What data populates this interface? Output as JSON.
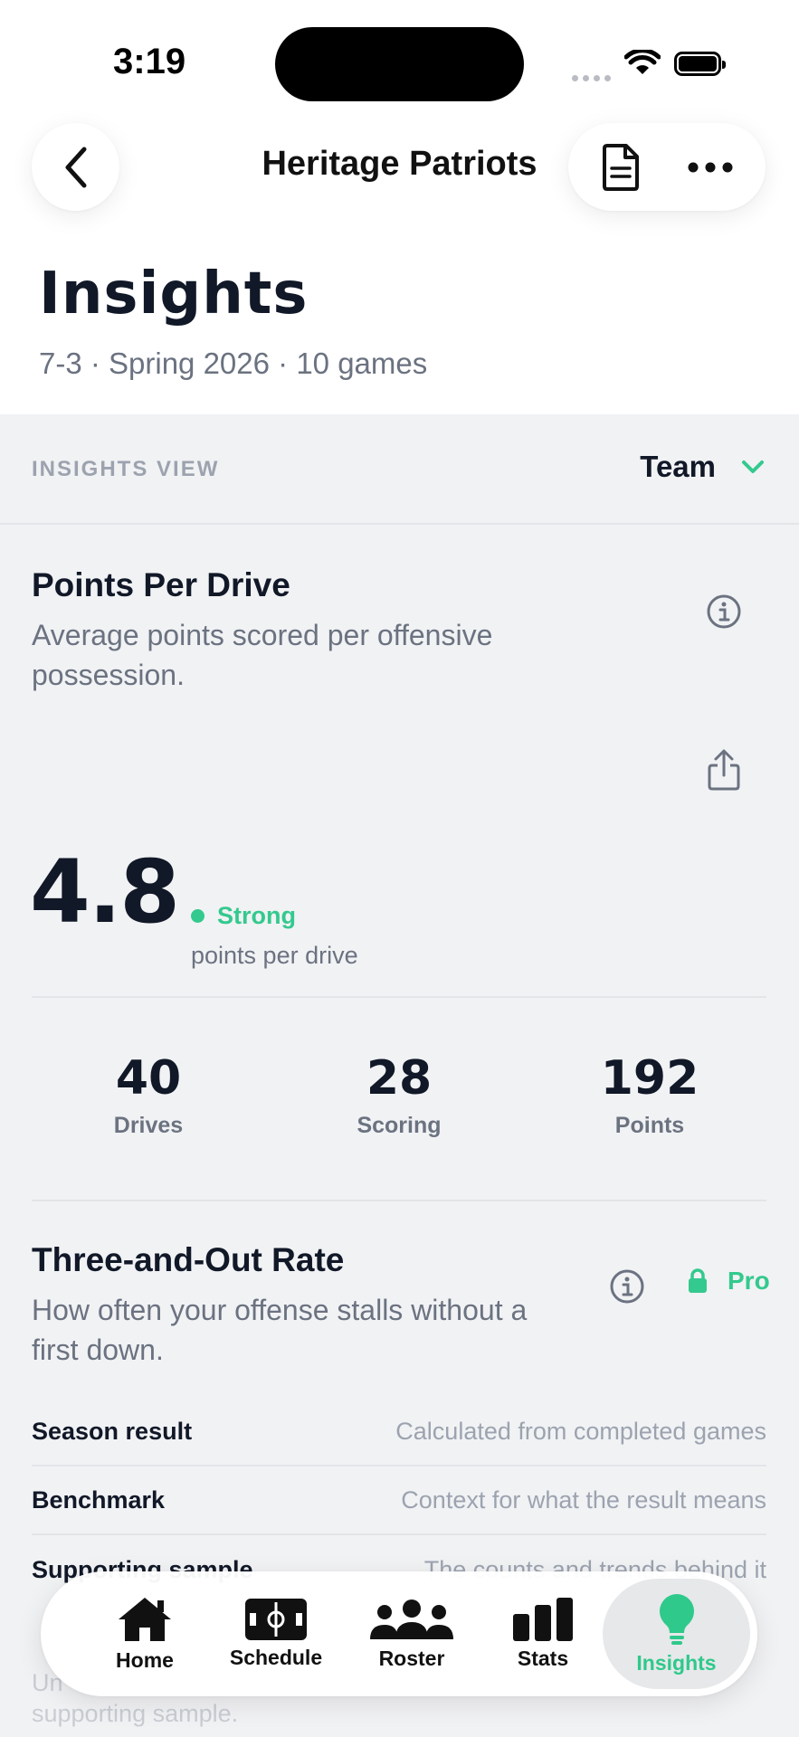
{
  "status_bar": {
    "time": "3:19"
  },
  "header": {
    "team_name": "Heritage Patriots"
  },
  "page": {
    "title": "Insights",
    "subtitle": "7-3 · Spring 2026 · 10 games"
  },
  "view_selector": {
    "label": "INSIGHTS VIEW",
    "value": "Team"
  },
  "points_per_drive": {
    "title": "Points Per Drive",
    "description": "Average points scored per offensive possession.",
    "value": "4.8",
    "rating": "Strong",
    "unit": "points per drive",
    "stats": [
      {
        "value": "40",
        "label": "Drives"
      },
      {
        "value": "28",
        "label": "Scoring"
      },
      {
        "value": "192",
        "label": "Points"
      }
    ]
  },
  "three_and_out": {
    "title": "Three-and-Out Rate",
    "description": "How often your offense stalls without a first down.",
    "badge": "Pro",
    "rows": [
      {
        "key": "Season result",
        "value": "Calculated from completed games"
      },
      {
        "key": "Benchmark",
        "value": "Context for what the result means"
      },
      {
        "key": "Supporting sample",
        "value": "The counts and trends behind it"
      }
    ],
    "footer_line1": "Un",
    "footer_line2": "supporting sample."
  },
  "tabs": [
    {
      "label": "Home",
      "icon": "home-icon"
    },
    {
      "label": "Schedule",
      "icon": "field-icon"
    },
    {
      "label": "Roster",
      "icon": "people-icon"
    },
    {
      "label": "Stats",
      "icon": "bar-chart-icon"
    },
    {
      "label": "Insights",
      "icon": "lightbulb-icon",
      "active": true
    }
  ],
  "colors": {
    "accent": "#34c98e",
    "background": "#f1f2f4",
    "text": "#111827",
    "muted": "#6b7280"
  }
}
